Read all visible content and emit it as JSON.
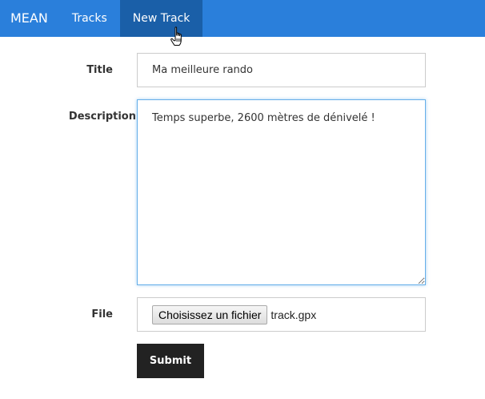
{
  "navbar": {
    "brand": "MEAN",
    "items": [
      {
        "label": "Tracks"
      },
      {
        "label": "New Track",
        "active": true
      }
    ],
    "color": "#2a7fdb",
    "active_color": "#1a5fa8"
  },
  "form": {
    "title_label": "Title",
    "title_value": "Ma meilleure rando",
    "description_label": "Description",
    "description_value": "Temps superbe, 2600 mètres de dénivelé !",
    "file_label": "File",
    "file_button": "Choisissez un fichier",
    "file_name": "track.gpx",
    "submit_label": "Submit"
  },
  "icons": {
    "cursor": "hand-pointer-icon"
  }
}
